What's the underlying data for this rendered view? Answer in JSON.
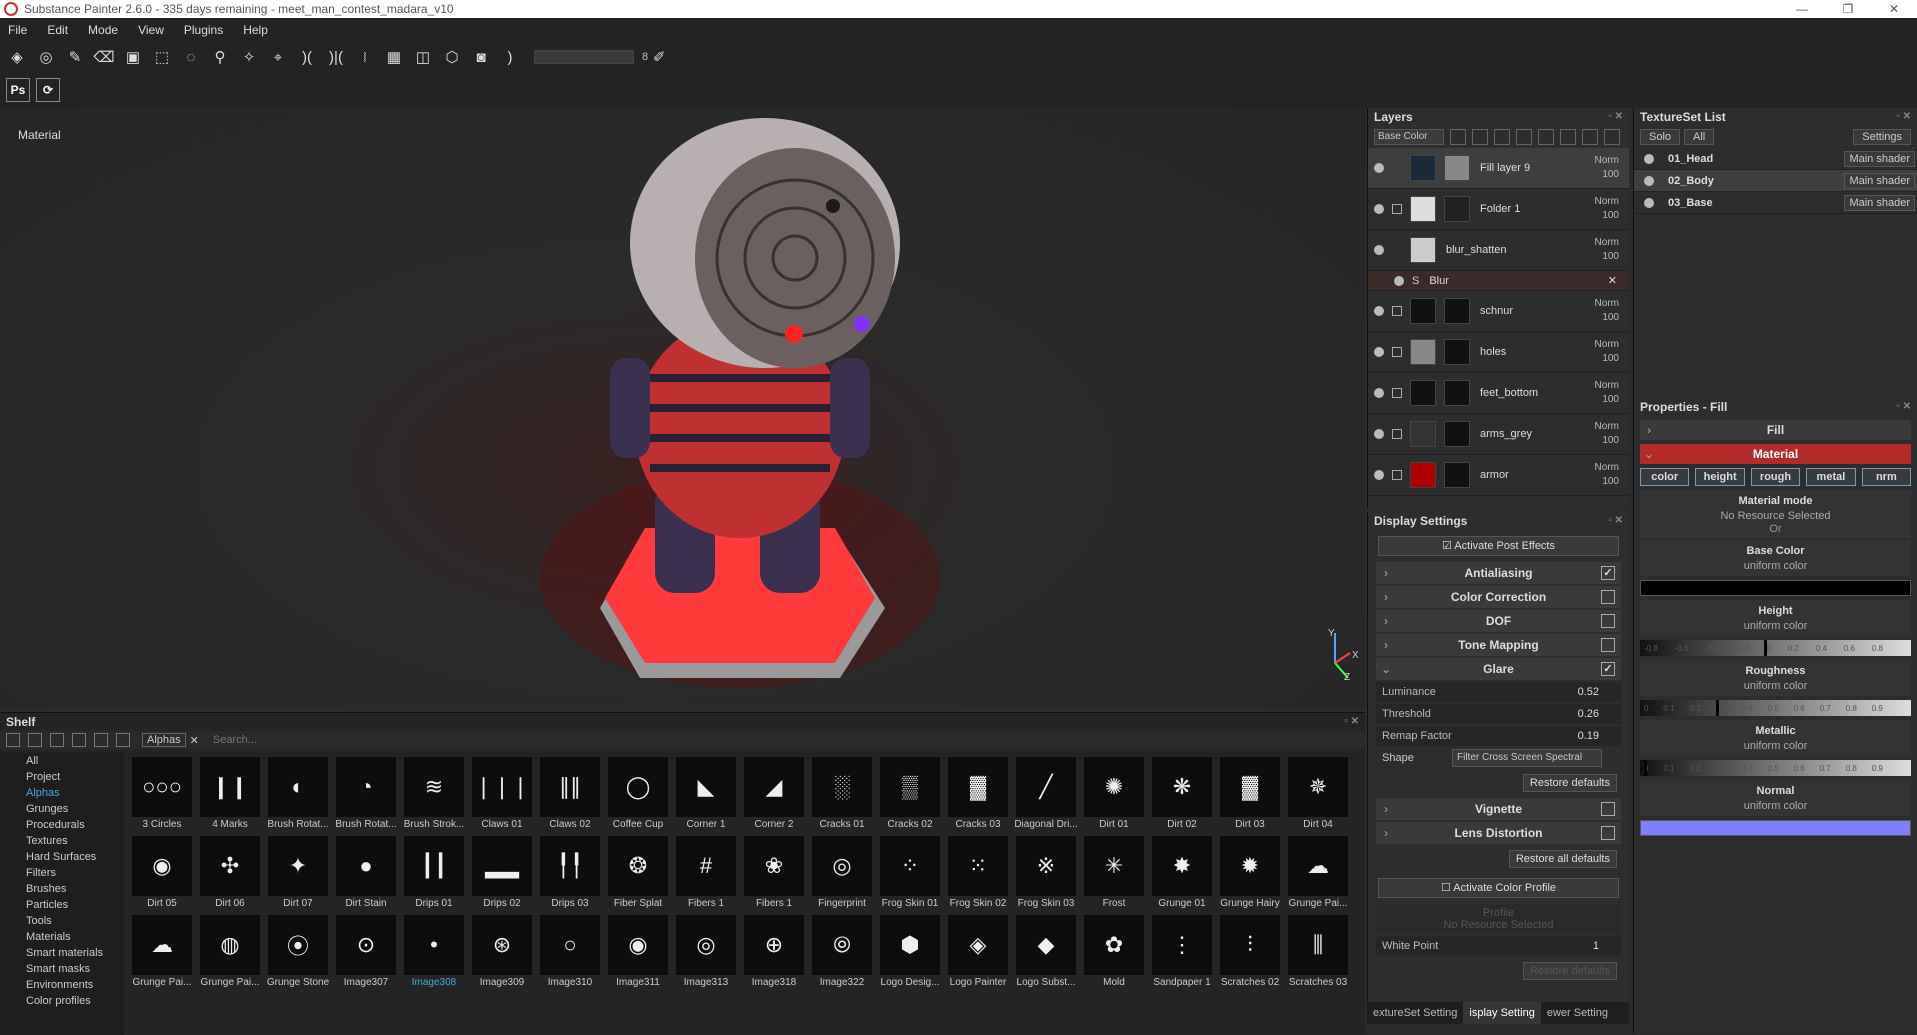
{
  "window": {
    "title": "Substance Painter 2.6.0 - 335 days remaining - meet_man_contest_madara_v10",
    "controls": [
      "—",
      "❐",
      "✕"
    ]
  },
  "menu": [
    "File",
    "Edit",
    "Mode",
    "View",
    "Plugins",
    "Help"
  ],
  "toolbar": {
    "brush_size": "8"
  },
  "toolbar2": {
    "ps_label": "Ps"
  },
  "viewport": {
    "label": "Material",
    "axis_labels": {
      "y": "Y",
      "x": "X",
      "z": "Z"
    }
  },
  "shelf": {
    "title": "Shelf",
    "filter_tag": "Alphas",
    "search_placeholder": "Search...",
    "categories": [
      "All",
      "Project",
      "Alphas",
      "Grunges",
      "Procedurals",
      "Textures",
      "Hard Surfaces",
      "Filters",
      "Brushes",
      "Particles",
      "Tools",
      "Materials",
      "Smart materials",
      "Smart masks",
      "Environments",
      "Color profiles"
    ],
    "active_category": "Alphas",
    "items": [
      "3 Circles",
      "4 Marks",
      "Brush Rotat...",
      "Brush Rotat...",
      "Brush Strok...",
      "Claws 01",
      "Claws 02",
      "Coffee Cup",
      "Corner 1",
      "Corner 2",
      "Cracks 01",
      "Cracks 02",
      "Cracks 03",
      "Diagonal Dri...",
      "Dirt 01",
      "Dirt 02",
      "Dirt 03",
      "Dirt 04",
      "Dirt 05",
      "Dirt 06",
      "Dirt 07",
      "Dirt Stain",
      "Drips 01",
      "Drips 02",
      "Drips 03",
      "Fiber Splat",
      "Fibers 1",
      "Fibers 1",
      "Fingerprint",
      "Frog Skin 01",
      "Frog Skin 02",
      "Frog Skin 03",
      "Frost",
      "Grunge 01",
      "Grunge Hairy",
      "Grunge Pai...",
      "Grunge Pai...",
      "Grunge Pai...",
      "Grunge Stone",
      "Image307",
      "Image308",
      "Image309",
      "Image310",
      "Image311",
      "Image313",
      "Image318",
      "Image322",
      "Logo Desig...",
      "Logo Painter",
      "Logo Subst...",
      "Mold",
      "Sandpaper 1",
      "Scratches 02",
      "Scratches 03"
    ],
    "selected_item": "Image308"
  },
  "layers": {
    "title": "Layers",
    "channel": "Base Color",
    "rows": [
      {
        "name": "Fill layer 9",
        "blend": "Norm",
        "opacity": "100"
      },
      {
        "name": "Folder 1",
        "blend": "Norm",
        "opacity": "100"
      },
      {
        "name": "blur_shatten",
        "blend": "Norm",
        "opacity": "100"
      },
      {
        "name": "schnur",
        "blend": "Norm",
        "opacity": "100"
      },
      {
        "name": "holes",
        "blend": "Norm",
        "opacity": "100"
      },
      {
        "name": "feet_bottom",
        "blend": "Norm",
        "opacity": "100"
      },
      {
        "name": "arms_grey",
        "blend": "Norm",
        "opacity": "100"
      },
      {
        "name": "armor",
        "blend": "Norm",
        "opacity": "100"
      }
    ],
    "sub_effect": "Blur"
  },
  "display": {
    "title": "Display Settings",
    "activate_post_effects": "Activate Post Effects",
    "sections": {
      "antialiasing": "Antialiasing",
      "color_correction": "Color Correction",
      "dof": "DOF",
      "tone_mapping": "Tone Mapping",
      "glare": "Glare",
      "vignette": "Vignette",
      "lens_distortion": "Lens Distortion"
    },
    "glare_params": [
      {
        "name": "Luminance",
        "value": "0.52"
      },
      {
        "name": "Threshold",
        "value": "0.26"
      },
      {
        "name": "Remap Factor",
        "value": "0.19"
      }
    ],
    "shape_label": "Shape",
    "shape_value": "Filter Cross Screen Spectral",
    "restore_defaults": "Restore defaults",
    "restore_all_defaults": "Restore all defaults",
    "activate_color_profile": "Activate Color Profile",
    "profile_label": "Profile",
    "profile_value": "No Resource Selected",
    "white_point_label": "White Point",
    "white_point_value": "1",
    "restore_defaults_2": "Restore defaults"
  },
  "bottom_tabs": [
    "extureSet Setting",
    "isplay Setting",
    "ewer Setting"
  ],
  "texture_set_list": {
    "title": "TextureSet List",
    "solo": "Solo",
    "all": "All",
    "settings": "Settings",
    "sets": [
      {
        "name": "01_Head",
        "shader": "Main shader"
      },
      {
        "name": "02_Body",
        "shader": "Main shader"
      },
      {
        "name": "03_Base",
        "shader": "Main shader"
      }
    ]
  },
  "properties": {
    "title": "Properties - Fill",
    "fill": "Fill",
    "material": "Material",
    "channels": [
      "color",
      "height",
      "rough",
      "metal",
      "nrm"
    ],
    "material_mode": "Material mode",
    "no_resource": "No Resource Selected",
    "or": "Or",
    "base_color": "Base Color",
    "uniform": "uniform color",
    "height": "Height",
    "roughness": "Roughness",
    "metallic": "Metallic",
    "normal": "Normal",
    "height_ticks": [
      "-0.8",
      "-0.6",
      "-0.4",
      "-0.2",
      "0",
      "0.2",
      "0.4",
      "0.6",
      "0.8"
    ],
    "unit_ticks": [
      "0",
      "0.1",
      "0.2",
      "0.3",
      "0.4",
      "0.5",
      "0.6",
      "0.7",
      "0.8",
      "0.9"
    ],
    "height_value": 0.0,
    "roughness_value": 0.3,
    "metallic_value": 0.0,
    "base_color_hex": "#000000",
    "normal_color_hex": "#7f7fff"
  },
  "colors": {
    "accent_red": "#b32a2a",
    "selection_blue": "#45a5e0"
  }
}
